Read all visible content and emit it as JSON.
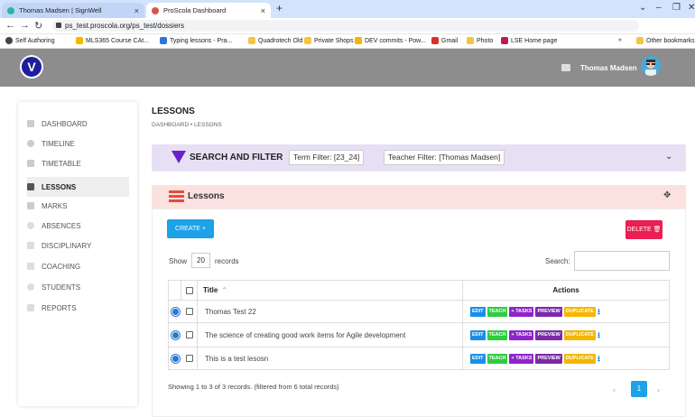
{
  "browser": {
    "tabs": [
      {
        "title": "Thomas Madsen | SignWell",
        "close": "×"
      },
      {
        "title": "ProScola Dashboard",
        "close": "×"
      }
    ],
    "new_tab": "+",
    "controls": {
      "minimize": "⌄",
      "restore": "–",
      "maximize": "❐",
      "close": "✕"
    },
    "url": "ps_test.proscola.org/ps_test/dossiers",
    "bookmarks": [
      {
        "label": "Self Authoring",
        "color": "#444"
      },
      {
        "label": "MLS365 Course CAt...",
        "color": "#f2b705"
      },
      {
        "label": "Typing lessons - Pra...",
        "color": "#2a76d2"
      },
      {
        "label": "Quadrotech Old",
        "color": "#f5c542"
      },
      {
        "label": "Private Shops",
        "color": "#f5c542"
      },
      {
        "label": "DEV commits - Pow...",
        "color": "#f2b705"
      },
      {
        "label": "Gmail",
        "color": "#d93025"
      },
      {
        "label": "Photo",
        "color": "#f5c542"
      },
      {
        "label": "LSE Home page",
        "color": "#c2185b"
      },
      {
        "label": "»",
        "color": ""
      },
      {
        "label": "Other bookmarks",
        "color": "#f5c542"
      }
    ]
  },
  "header": {
    "username": "Thomas Madsen"
  },
  "sidebar": {
    "items": [
      {
        "label": "DASHBOARD",
        "active": false
      },
      {
        "label": "TIMELINE",
        "active": false
      },
      {
        "label": "TIMETABLE",
        "active": false
      },
      {
        "label": "LESSONS",
        "active": true
      },
      {
        "label": "MARKS",
        "active": false
      },
      {
        "label": "ABSENCES",
        "active": false
      },
      {
        "label": "DISCIPLINARY",
        "active": false
      },
      {
        "label": "COACHING",
        "active": false
      },
      {
        "label": "STUDENTS",
        "active": false
      },
      {
        "label": "REPORTS",
        "active": false
      }
    ]
  },
  "page": {
    "title": "LESSONS",
    "breadcrumb": "DASHBOARD • LESSONS"
  },
  "filter": {
    "title": "SEARCH AND FILTER",
    "term": "Term Filter: [23_24]",
    "teacher": "Teacher Filter: [Thomas Madsen]"
  },
  "lessons": {
    "title": "Lessons",
    "create_label": "CREATE +",
    "delete_label": "DELETE 🗑",
    "show_label": "Show",
    "show_value": "20",
    "records_label": "records",
    "search_label": "Search:",
    "columns": {
      "title": "Title",
      "actions": "Actions"
    },
    "action_labels": {
      "edit": "EDIT",
      "teach": "TEACH",
      "tasks": "+ TASKS",
      "preview": "PREVIEW",
      "duplicate": "DUPLICATE"
    },
    "rows": [
      {
        "title": "Thomas Test 22"
      },
      {
        "title": "The science of creating good work items for Agile development"
      },
      {
        "title": "This is a test lesosn"
      }
    ],
    "showing": "Showing 1 to 3 of 3 records. (filtered from 6 total records)",
    "pagination": {
      "prev": "‹",
      "current": "1",
      "next": "›"
    }
  }
}
